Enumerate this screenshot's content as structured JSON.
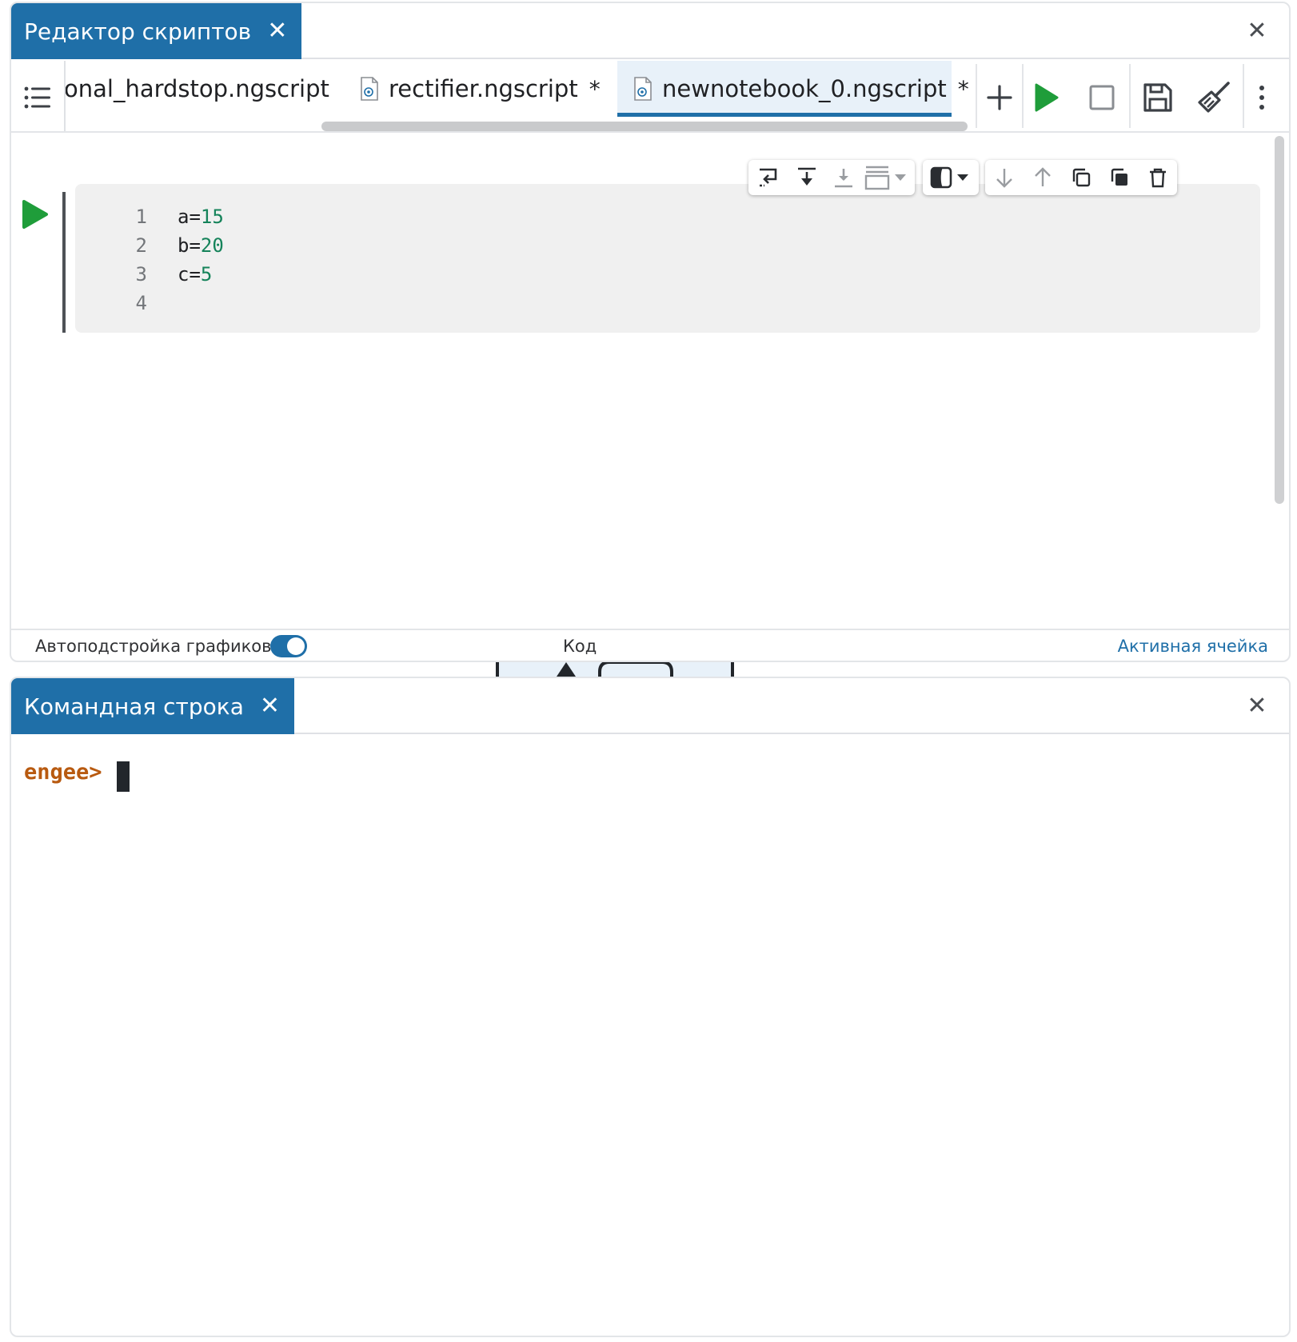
{
  "editor": {
    "panel_title": "Редактор скриптов",
    "tabs": [
      {
        "label": "onal_hardstop.ngscript",
        "modified": "",
        "active": false
      },
      {
        "label": "rectifier.ngscript",
        "modified": "*",
        "active": false
      },
      {
        "label": "newnotebook_0.ngscript",
        "modified": "*",
        "active": true
      }
    ],
    "code_lines": [
      {
        "n": "1",
        "var": "a=",
        "val": "15"
      },
      {
        "n": "2",
        "var": "b=",
        "val": "20"
      },
      {
        "n": "3",
        "var": "c=",
        "val": "5"
      },
      {
        "n": "4",
        "var": "",
        "val": ""
      }
    ],
    "status": {
      "autofit_label": "Автоподстройка графиков",
      "autofit_on": true,
      "mode_label": "Код",
      "active_cell_label": "Активная ячейка"
    }
  },
  "console": {
    "panel_title": "Командная строка",
    "prompt": "engee>"
  },
  "colors": {
    "accent": "#1f6fa8",
    "run_green": "#1f9d3a",
    "code_number": "#15835a",
    "prompt": "#b85a10"
  },
  "icons": {
    "toolbar": [
      "list-icon",
      "plus-icon",
      "play-icon",
      "stop-icon",
      "save-icon",
      "broom-icon",
      "more-vertical-icon"
    ],
    "cell_toolbar": [
      "wrap-icon",
      "run-to-bottom-icon",
      "download-icon",
      "layout-icon",
      "theme-icon",
      "move-down-icon",
      "move-up-icon",
      "copy-icon",
      "paste-icon",
      "trash-icon"
    ]
  }
}
